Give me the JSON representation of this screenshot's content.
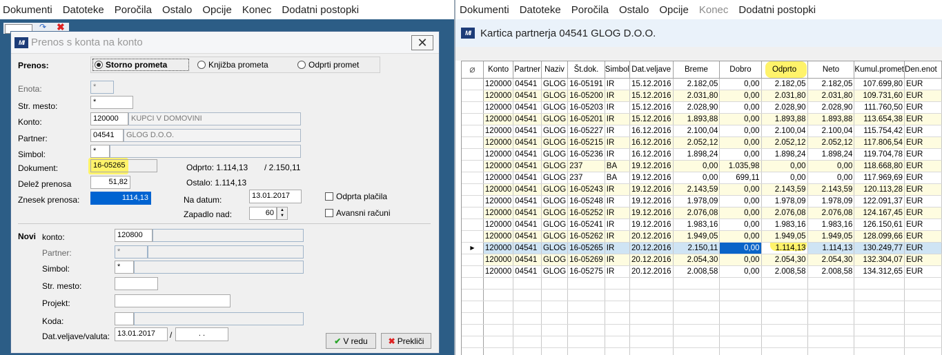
{
  "left_menu": [
    "Dokumenti",
    "Datoteke",
    "Poročila",
    "Ostalo",
    "Opcije",
    "Konec",
    "Dodatni postopki"
  ],
  "right_menu": [
    "Dokumenti",
    "Datoteke",
    "Poročila",
    "Ostalo",
    "Opcije",
    "Konec",
    "Dodatni postopki"
  ],
  "logo_text": "MI",
  "dialog": {
    "title": "Prenos s konta na konto",
    "close_symbol": "✕",
    "prenos_label": "Prenos:",
    "radio": [
      {
        "label": "Storno prometa",
        "selected": true
      },
      {
        "label": "Knjižba prometa",
        "selected": false
      },
      {
        "label": "Odprti promet",
        "selected": false
      }
    ],
    "enota_label": "Enota:",
    "enota_value": "*",
    "str_mesto_label": "Str. mesto:",
    "str_mesto_value": "*",
    "konto_label": "Konto:",
    "konto_value": "120000",
    "konto_name": "KUPCI V DOMOVINI",
    "partner_label": "Partner:",
    "partner_value": "04541",
    "partner_name": "GLOG D.O.O.",
    "simbol_label": "Simbol:",
    "simbol_value": "*",
    "dokument_label": "Dokument:",
    "dokument_value": "16-05265",
    "odprto_text": "Odprto: 1.114,13",
    "odprto_total": "/ 2.150,11",
    "delez_label": "Delež prenosa",
    "delez_value": "51,82",
    "ostalo_text": "Ostalo: 1.114,13",
    "znesek_label": "Znesek prenosa:",
    "znesek_value": "1114,13",
    "na_datum_label": "Na datum:",
    "na_datum_value": "13.01.2017",
    "zapadlo_label": "Zapadlo nad:",
    "zapadlo_value": "60",
    "odprta_placila_label": "Odprta plačila",
    "avansni_label": "Avansni računi",
    "novi_label": "Novi",
    "novi_konto_label": "konto:",
    "novi_konto_value": "120800",
    "novi_partner_label": "Partner:",
    "novi_partner_value": "*",
    "novi_simbol_label": "Simbol:",
    "novi_simbol_value": "*",
    "novi_str_mesto_label": "Str. mesto:",
    "projekt_label": "Projekt:",
    "koda_label": "Koda:",
    "dat_veljave_label": "Dat.veljave/valuta:",
    "dat_veljave_value": "13.01.2017",
    "slash": "/",
    "valuta_value": ". .",
    "ok_label": "V redu",
    "cancel_label": "Prekliči"
  },
  "kartica": {
    "title": "Kartica partnerja 04541 GLOG D.O.O.",
    "columns": [
      "Konto",
      "Partner",
      "Naziv",
      "Št.dok.",
      "Simbol",
      "Dat.veljave",
      "Breme",
      "Dobro",
      "Odprto",
      "Neto",
      "Kumul.promet",
      "Den.enot"
    ],
    "rows": [
      [
        "120000",
        "04541",
        "GLOG",
        "16-05191",
        "IR",
        "15.12.2016",
        "2.182,05",
        "0,00",
        "2.182,05",
        "2.182,05",
        "107.699,80",
        "EUR"
      ],
      [
        "120000",
        "04541",
        "GLOG",
        "16-05200",
        "IR",
        "15.12.2016",
        "2.031,80",
        "0,00",
        "2.031,80",
        "2.031,80",
        "109.731,60",
        "EUR"
      ],
      [
        "120000",
        "04541",
        "GLOG",
        "16-05203",
        "IR",
        "15.12.2016",
        "2.028,90",
        "0,00",
        "2.028,90",
        "2.028,90",
        "111.760,50",
        "EUR"
      ],
      [
        "120000",
        "04541",
        "GLOG",
        "16-05201",
        "IR",
        "15.12.2016",
        "1.893,88",
        "0,00",
        "1.893,88",
        "1.893,88",
        "113.654,38",
        "EUR"
      ],
      [
        "120000",
        "04541",
        "GLOG",
        "16-05227",
        "IR",
        "16.12.2016",
        "2.100,04",
        "0,00",
        "2.100,04",
        "2.100,04",
        "115.754,42",
        "EUR"
      ],
      [
        "120000",
        "04541",
        "GLOG",
        "16-05215",
        "IR",
        "16.12.2016",
        "2.052,12",
        "0,00",
        "2.052,12",
        "2.052,12",
        "117.806,54",
        "EUR"
      ],
      [
        "120000",
        "04541",
        "GLOG",
        "16-05236",
        "IR",
        "16.12.2016",
        "1.898,24",
        "0,00",
        "1.898,24",
        "1.898,24",
        "119.704,78",
        "EUR"
      ],
      [
        "120000",
        "04541",
        "GLOG",
        "237",
        "BA",
        "19.12.2016",
        "0,00",
        "1.035,98",
        "0,00",
        "0,00",
        "118.668,80",
        "EUR"
      ],
      [
        "120000",
        "04541",
        "GLOG",
        "237",
        "BA",
        "19.12.2016",
        "0,00",
        "699,11",
        "0,00",
        "0,00",
        "117.969,69",
        "EUR"
      ],
      [
        "120000",
        "04541",
        "GLOG",
        "16-05243",
        "IR",
        "19.12.2016",
        "2.143,59",
        "0,00",
        "2.143,59",
        "2.143,59",
        "120.113,28",
        "EUR"
      ],
      [
        "120000",
        "04541",
        "GLOG",
        "16-05248",
        "IR",
        "19.12.2016",
        "1.978,09",
        "0,00",
        "1.978,09",
        "1.978,09",
        "122.091,37",
        "EUR"
      ],
      [
        "120000",
        "04541",
        "GLOG",
        "16-05252",
        "IR",
        "19.12.2016",
        "2.076,08",
        "0,00",
        "2.076,08",
        "2.076,08",
        "124.167,45",
        "EUR"
      ],
      [
        "120000",
        "04541",
        "GLOG",
        "16-05241",
        "IR",
        "19.12.2016",
        "1.983,16",
        "0,00",
        "1.983,16",
        "1.983,16",
        "126.150,61",
        "EUR"
      ],
      [
        "120000",
        "04541",
        "GLOG",
        "16-05262",
        "IR",
        "20.12.2016",
        "1.949,05",
        "0,00",
        "1.949,05",
        "1.949,05",
        "128.099,66",
        "EUR"
      ],
      [
        "120000",
        "04541",
        "GLOG",
        "16-05265",
        "IR",
        "20.12.2016",
        "2.150,11",
        "0,00",
        "1.114,13",
        "1.114,13",
        "130.249,77",
        "EUR"
      ],
      [
        "120000",
        "04541",
        "GLOG",
        "16-05269",
        "IR",
        "20.12.2016",
        "2.054,30",
        "0,00",
        "2.054,30",
        "2.054,30",
        "132.304,07",
        "EUR"
      ],
      [
        "120000",
        "04541",
        "GLOG",
        "16-05275",
        "IR",
        "20.12.2016",
        "2.008,58",
        "0,00",
        "2.008,58",
        "2.008,58",
        "134.312,65",
        "EUR"
      ]
    ],
    "selected_row": 14,
    "row_indicator": "▶"
  }
}
